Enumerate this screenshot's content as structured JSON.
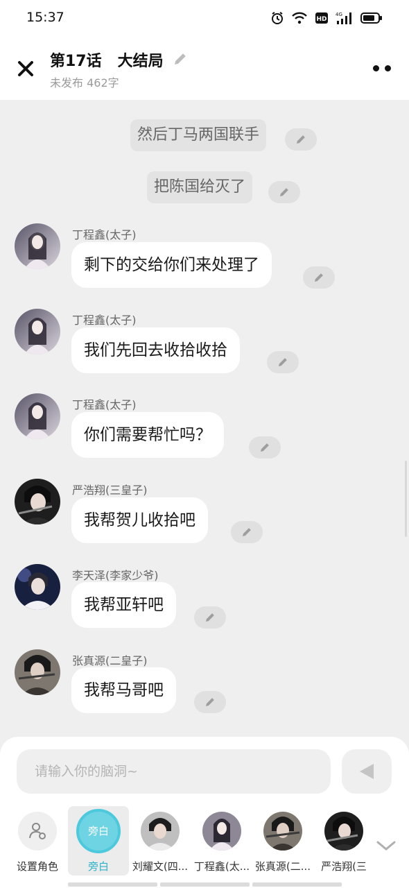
{
  "status": {
    "time": "15:37",
    "icons": [
      "alarm-icon",
      "wifi-icon",
      "hd-icon",
      "signal-4g-icon",
      "battery-icon"
    ]
  },
  "header": {
    "title": "第17话   大结局",
    "subtitle": "未发布 462字"
  },
  "messages": [
    {
      "type": "narration",
      "text": "然后丁马两国联手"
    },
    {
      "type": "narration",
      "text": "把陈国给灭了"
    },
    {
      "type": "dialogue",
      "speaker": "丁程鑫(太子)",
      "text": "剩下的交给你们来处理了"
    },
    {
      "type": "dialogue",
      "speaker": "丁程鑫(太子)",
      "text": "我们先回去收拾收拾"
    },
    {
      "type": "dialogue",
      "speaker": "丁程鑫(太子)",
      "text": "你们需要帮忙吗？"
    },
    {
      "type": "dialogue",
      "speaker": "严浩翔(三皇子)",
      "text": "我帮贺儿收拾吧"
    },
    {
      "type": "dialogue",
      "speaker": "李天泽(李家少爷)",
      "text": "我帮亚轩吧"
    },
    {
      "type": "dialogue",
      "speaker": "张真源(二皇子)",
      "text": "我帮马哥吧"
    }
  ],
  "composer": {
    "placeholder": "请输入你的脑洞~"
  },
  "roles": [
    {
      "label": "设置角色",
      "icon": "role-settings-icon"
    },
    {
      "label": "旁白",
      "badge": "旁白",
      "active": true
    },
    {
      "label": "刘耀文(四..."
    },
    {
      "label": "丁程鑫(太..."
    },
    {
      "label": "张真源(二..."
    },
    {
      "label": "严浩翔(三"
    }
  ],
  "colors": {
    "accent": "#4cc9dc",
    "background": "#efefef",
    "bubble": "#ffffff"
  }
}
